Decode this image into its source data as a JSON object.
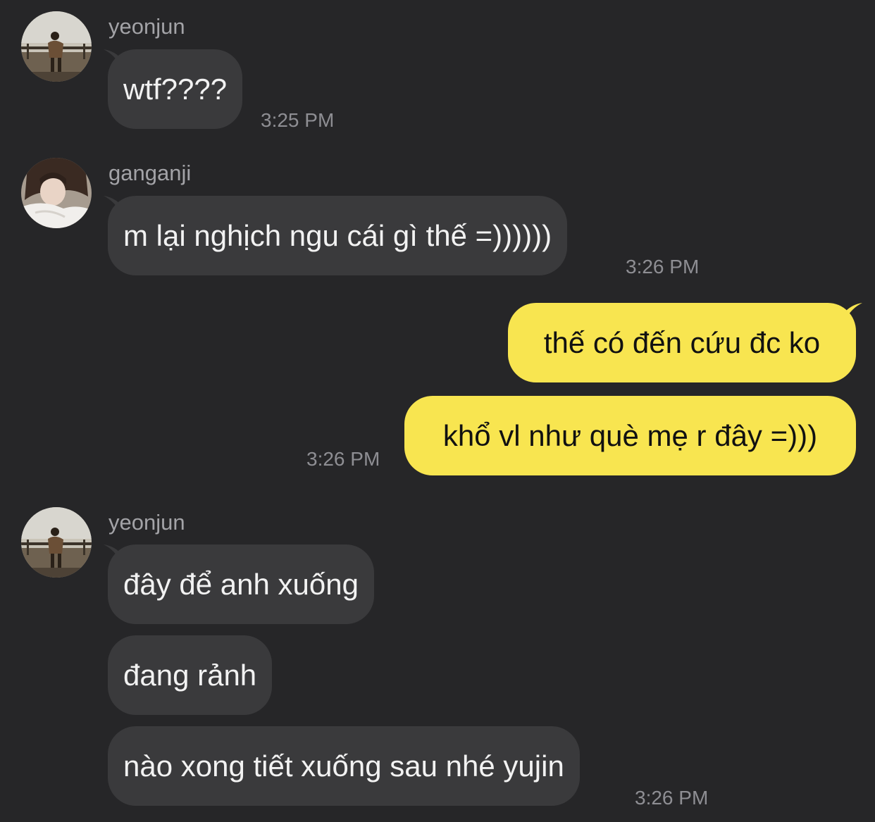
{
  "messages": [
    {
      "sender": "yeonjun",
      "text": "wtf????",
      "time": "3:25 PM"
    },
    {
      "sender": "ganganji",
      "text": "m lại nghịch ngu cái gì thế =))))))",
      "time": "3:26 PM"
    },
    {
      "text": "thế có đến cứu đc ko"
    },
    {
      "text": "khổ vl như què mẹ r đây =)))",
      "time": "3:26 PM"
    },
    {
      "sender": "yeonjun",
      "text": "đây để anh xuống"
    },
    {
      "text": "đang rảnh"
    },
    {
      "text": "nào xong tiết xuống sau nhé yujin",
      "time": "3:26 PM"
    }
  ],
  "colors": {
    "background": "#262628",
    "incoming_bubble": "#3a3a3c",
    "outgoing_bubble": "#f8e550",
    "sender_name": "#a3a3a7",
    "timestamp": "#8e8e93"
  },
  "icons": {
    "avatar_yeonjun": "avatar-photo",
    "avatar_ganganji": "avatar-photo"
  }
}
